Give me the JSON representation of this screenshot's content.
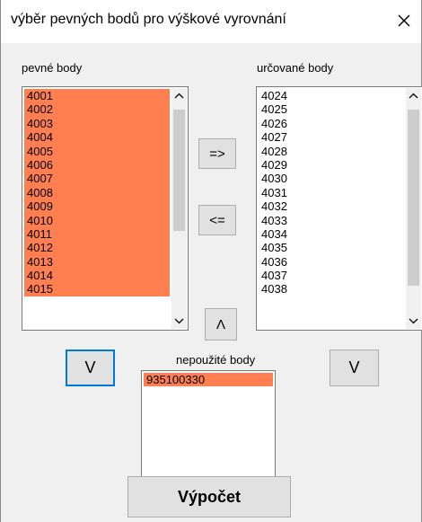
{
  "window": {
    "title": "výběr pevných bodů pro výškové vyrovnání",
    "close_glyph": "✕"
  },
  "fixed_points": {
    "label": "pevné body",
    "items": [
      "4001",
      "4002",
      "4003",
      "4004",
      "4005",
      "4006",
      "4007",
      "4008",
      "4009",
      "4010",
      "4011",
      "4012",
      "4013",
      "4014",
      "4015"
    ]
  },
  "determined_points": {
    "label": "určované body",
    "items": [
      "4024",
      "4025",
      "4026",
      "4027",
      "4028",
      "4029",
      "4030",
      "4031",
      "4032",
      "4033",
      "4034",
      "4035",
      "4036",
      "4037",
      "4038"
    ]
  },
  "unused_points": {
    "label": "nepoužité body",
    "items": [
      "935100330"
    ]
  },
  "buttons": {
    "move_right": "=>",
    "move_left": "<=",
    "move_up": "Λ",
    "move_down_left": "V",
    "move_down_right": "V",
    "calculate": "Výpočet"
  },
  "colors": {
    "selection": "#ff7f50",
    "focus_border": "#0078d7",
    "button_face": "#e1e1e1",
    "dialog_background": "#f0f0f0"
  },
  "icons": {
    "close": "close-icon",
    "scroll_up": "chevron-up-icon",
    "scroll_down": "chevron-down-icon"
  }
}
